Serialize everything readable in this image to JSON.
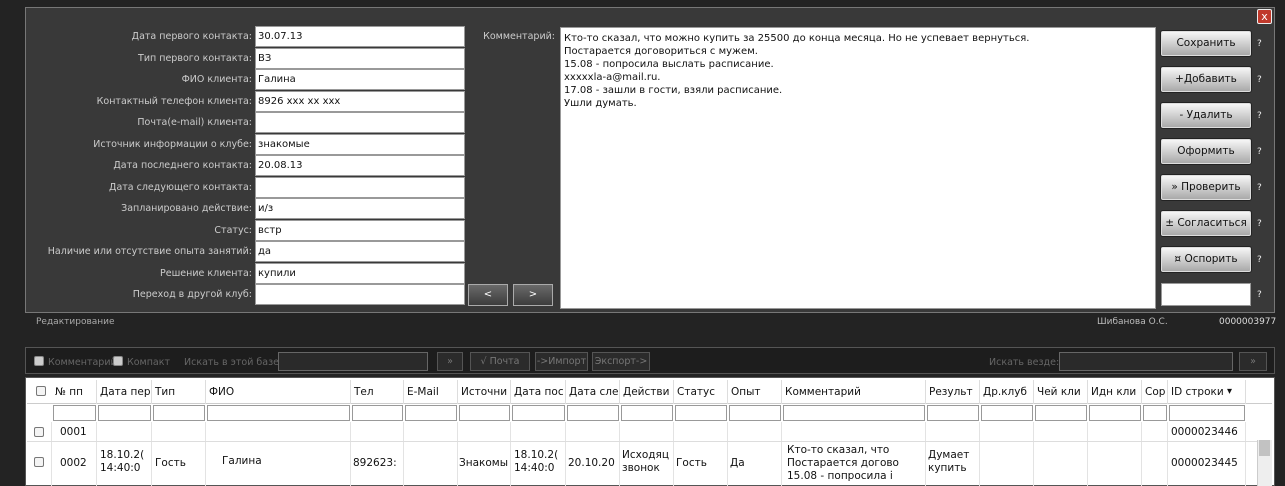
{
  "form": {
    "fields": [
      {
        "label": "Дата первого контакта:",
        "value": "30.07.13"
      },
      {
        "label": "Тип первого контакта:",
        "value": "ВЗ"
      },
      {
        "label": "ФИО клиента:",
        "value": "Галина"
      },
      {
        "label": "Контактный телефон клиента:",
        "value": "8926 xxx xx xxx"
      },
      {
        "label": "Почта(e-mail) клиента:",
        "value": ""
      },
      {
        "label": "Источник информации о клубе:",
        "value": "знакомые"
      },
      {
        "label": "Дата последнего контакта:",
        "value": "20.08.13"
      },
      {
        "label": "Дата следующего контакта:",
        "value": ""
      },
      {
        "label": "Запланировано действие:",
        "value": "и/з"
      },
      {
        "label": "Статус:",
        "value": "встр"
      },
      {
        "label": "Наличие или отсутствие опыта занятий:",
        "value": "да"
      },
      {
        "label": "Решение клиента:",
        "value": "купили"
      },
      {
        "label": "Переход в другой клуб:",
        "value": ""
      }
    ],
    "comment_label": "Комментарий:",
    "comment": "Кто-то сказал, что можно купить за 25500 до конца месяца. Но не успевает вернуться.\nПостарается договориться с мужем.\n15.08 - попросила выслать расписание.\nxxxxxla-a@mail.ru.\n17.08 - зашли в гости, взяли расписание.\nУшли думать.",
    "prev_label": "<",
    "next_label": ">",
    "close_label": "x"
  },
  "actions": [
    {
      "label": "Сохранить"
    },
    {
      "label": "+Добавить"
    },
    {
      "label": "- Удалить"
    },
    {
      "label": "Оформить"
    },
    {
      "label": "» Проверить"
    },
    {
      "label": "± Согласиться"
    },
    {
      "label": "¤ Оспорить"
    }
  ],
  "help_mark": "?",
  "status": {
    "mode": "Редактирование",
    "user": "Шибанова О.С.",
    "record_id": "0000003977"
  },
  "toolbar": {
    "comment_label": "Комментарий",
    "compact_label": "Компакт",
    "search_base_label": "Искать в этой базе:",
    "search_go": "»",
    "mail_btn": "√ Почта",
    "import_btn": "->Импорт",
    "export_btn": "Экспорт->",
    "search_all_label": "Искать везде:",
    "search_all_go": "»"
  },
  "grid": {
    "columns": [
      "№ пп",
      "Дата пер",
      "Тип",
      "ФИО",
      "Тел",
      "E-Mail",
      "Источни",
      "Дата пос",
      "Дата сле",
      "Действи",
      "Статус",
      "Опыт",
      "Комментарий",
      "Результ",
      "Др.клуб",
      "Чей кли",
      "Идн кли",
      "Сор",
      "ID строки"
    ],
    "sort_icon": "▾",
    "rows": [
      {
        "num": "0001",
        "id": "0000023446"
      },
      {
        "num": "0002",
        "date_first": "18.10.2(\n14:40:0",
        "type": "Гость",
        "name": "Галина",
        "phone": "892623:",
        "source": "Знакомы",
        "date_last": "18.10.2(\n14:40:0",
        "date_next": "20.10.20",
        "action": "Исходяц\nзвонок",
        "status": "Гость",
        "exp": "Да",
        "comment": "Кто-то сказал, что\nПостарается догово\n15.08 - попросила і",
        "result": "Думает\nкупить",
        "id": "0000023445"
      }
    ]
  }
}
